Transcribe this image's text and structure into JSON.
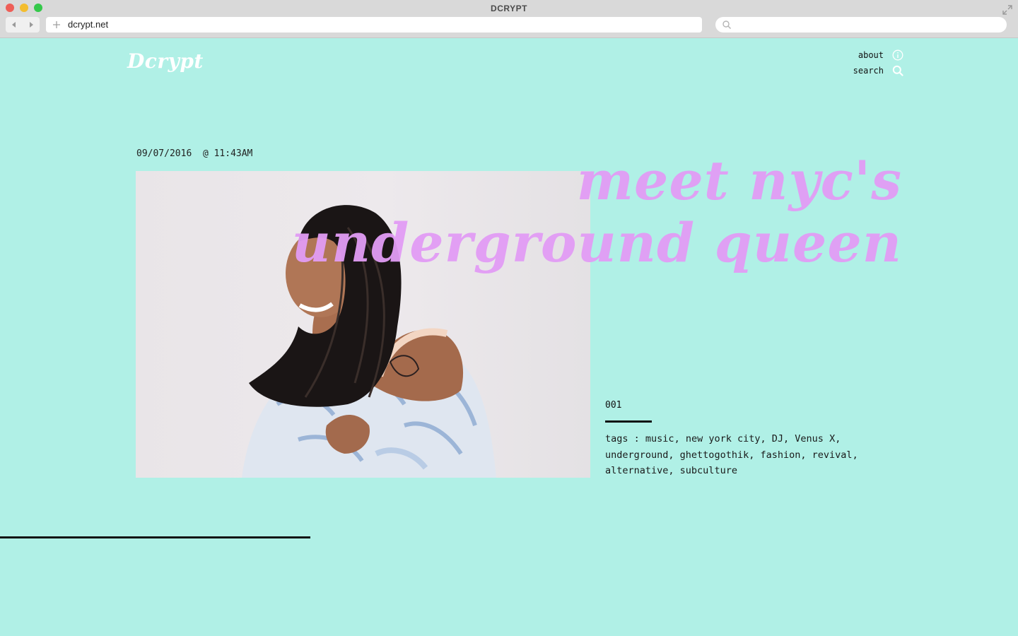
{
  "browser": {
    "window_title": "DCRYPT",
    "url": "dcrypt.net",
    "search_placeholder": ""
  },
  "site": {
    "logo": "Dcrypt",
    "nav": [
      {
        "label": "about",
        "icon": "info-icon"
      },
      {
        "label": "search",
        "icon": "search-icon"
      }
    ]
  },
  "article": {
    "date": "09/07/2016",
    "time": "@ 11:43AM",
    "headline_line1": "meet nyc's",
    "headline_line2": "underground queen",
    "issue_number": "001",
    "tags_label": "tags :",
    "tags": [
      "music",
      "new york city",
      "DJ",
      "Venus X",
      "underground",
      "ghettogothik",
      "fashion",
      "revival",
      "alternative",
      "subculture"
    ],
    "photo": "portrait photo of a smiling woman"
  },
  "progress": {
    "fraction": 0.305
  },
  "colors": {
    "background": "#b0f0e6",
    "headline": "#e29cf5",
    "text": "#111111",
    "logo": "#ffffff"
  }
}
